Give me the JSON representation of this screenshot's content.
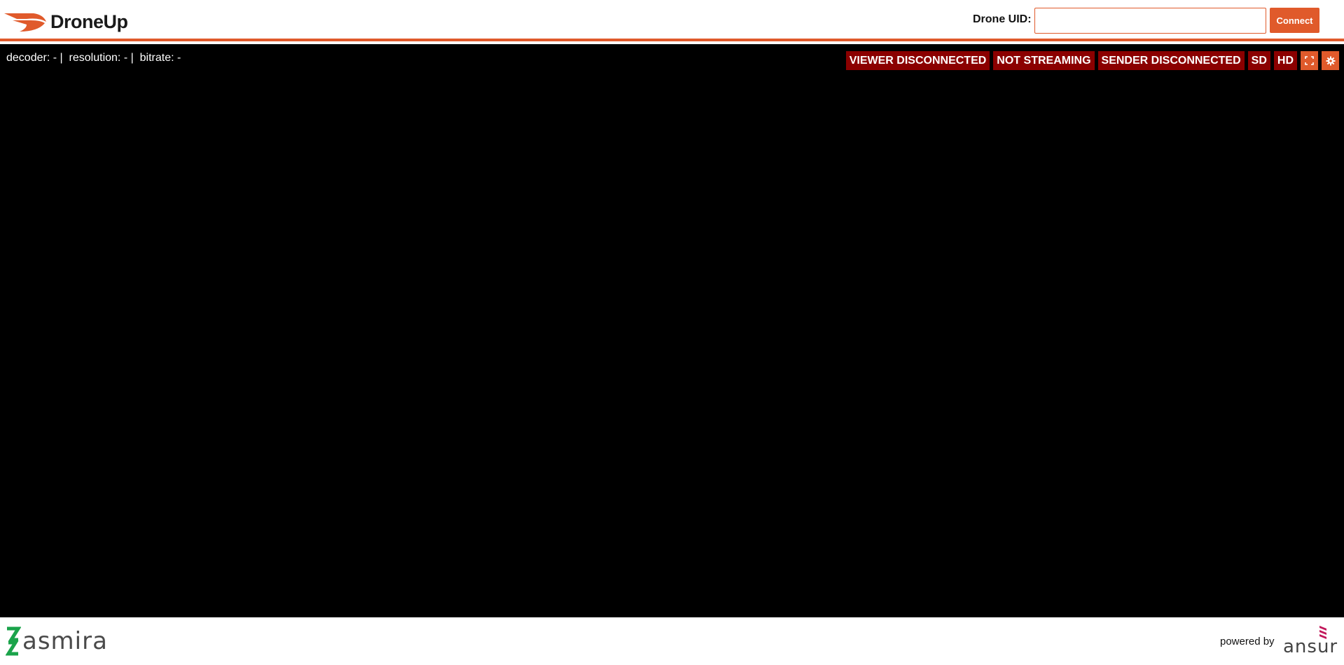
{
  "header": {
    "brand": "DroneUp",
    "uid_label": "Drone UID:",
    "uid_value": "",
    "uid_placeholder": "",
    "connect_label": "Connect"
  },
  "stats": {
    "decoder_label": "decoder:",
    "decoder_value": "-",
    "resolution_label": "resolution:",
    "resolution_value": "-",
    "bitrate_label": "bitrate:",
    "bitrate_value": "-",
    "separator": "|"
  },
  "status": {
    "viewer": "VIEWER DISCONNECTED",
    "stream": "NOT STREAMING",
    "sender": "SENDER DISCONNECTED",
    "sd": "SD",
    "hd": "HD",
    "fullscreen_icon": "fullscreen-icon",
    "settings_icon": "gear-icon"
  },
  "footer": {
    "asmira_brand": "asmira",
    "powered_by": "powered by",
    "ansur_brand": "ansur"
  },
  "colors": {
    "accent": "#e05a2b",
    "status_badge": "#8b0000",
    "video_bg": "#000000"
  }
}
